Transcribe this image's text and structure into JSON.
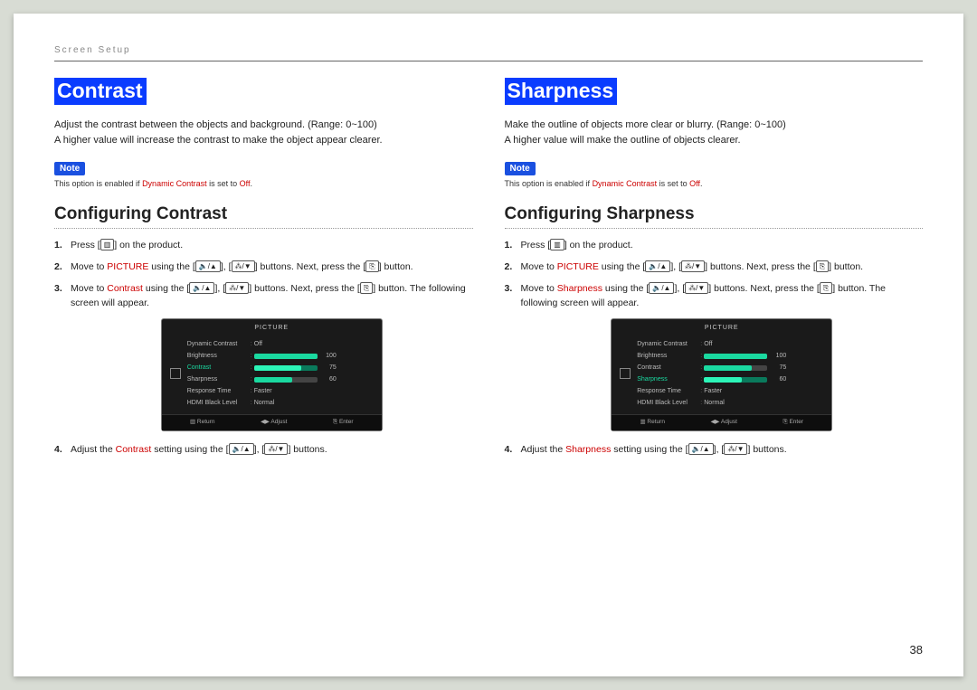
{
  "header": "Screen Setup",
  "page_number": "38",
  "icons": {
    "menu": "▥",
    "up": "🔈/▲",
    "down": "⁂/▼",
    "enter": "⎘"
  },
  "left": {
    "title": "Contrast",
    "desc_line1": "Adjust the contrast between the objects and background. (Range: 0~100)",
    "desc_line2": "A higher value will increase the contrast to make the object appear clearer.",
    "note_badge": "Note",
    "note_prefix": "This option is enabled if ",
    "note_dc": "Dynamic Contrast",
    "note_suffix": " is set to ",
    "note_off": "Off",
    "h2": "Configuring Contrast",
    "step1_a": "Press [",
    "step1_b": "] on the product.",
    "step2_a": "Move to ",
    "step2_pic": "PICTURE",
    "step2_b": " using the [",
    "step2_c": "], [",
    "step2_d": "] buttons. Next, press the [",
    "step2_e": "] button.",
    "step3_a": "Move to ",
    "step3_item": "Contrast",
    "step3_b": " using the [",
    "step3_c": "], [",
    "step3_d": "] buttons. Next, press the [",
    "step3_e": "] button. The following screen will appear.",
    "step4_a": "Adjust the ",
    "step4_item": "Contrast",
    "step4_b": " setting using the [",
    "step4_c": "], [",
    "step4_d": "] buttons.",
    "osd": {
      "title": "PICTURE",
      "rows": [
        {
          "label": "Dynamic Contrast",
          "type": "text",
          "value": "Off"
        },
        {
          "label": "Brightness",
          "type": "bar",
          "value": 100,
          "pct": 100
        },
        {
          "label": "Contrast",
          "type": "bar",
          "value": 75,
          "pct": 75,
          "hl": true
        },
        {
          "label": "Sharpness",
          "type": "bar",
          "value": 60,
          "pct": 60
        },
        {
          "label": "Response Time",
          "type": "text",
          "value": "Faster"
        },
        {
          "label": "HDMI Black Level",
          "type": "text",
          "value": "Normal"
        }
      ],
      "foot": [
        "▥ Return",
        "◀▶ Adjust",
        "⎘ Enter"
      ]
    }
  },
  "right": {
    "title": "Sharpness",
    "desc_line1": "Make the outline of objects more clear or blurry. (Range: 0~100)",
    "desc_line2": "A higher value will make the outline of objects clearer.",
    "note_badge": "Note",
    "note_prefix": "This option is enabled if ",
    "note_dc": "Dynamic Contrast",
    "note_suffix": " is set to ",
    "note_off": "Off",
    "h2": "Configuring Sharpness",
    "step1_a": "Press [",
    "step1_b": "] on the product.",
    "step2_a": "Move to ",
    "step2_pic": "PICTURE",
    "step2_b": " using the [",
    "step2_c": "], [",
    "step2_d": "] buttons. Next, press the [",
    "step2_e": "] button.",
    "step3_a": "Move to ",
    "step3_item": "Sharpness",
    "step3_b": " using the [",
    "step3_c": "], [",
    "step3_d": "] buttons. Next, press the [",
    "step3_e": "] button. The following screen will appear.",
    "step4_a": "Adjust the ",
    "step4_item": "Sharpness",
    "step4_b": " setting using the [",
    "step4_c": "], [",
    "step4_d": "] buttons.",
    "osd": {
      "title": "PICTURE",
      "rows": [
        {
          "label": "Dynamic Contrast",
          "type": "text",
          "value": "Off"
        },
        {
          "label": "Brightness",
          "type": "bar",
          "value": 100,
          "pct": 100
        },
        {
          "label": "Contrast",
          "type": "bar",
          "value": 75,
          "pct": 75
        },
        {
          "label": "Sharpness",
          "type": "bar",
          "value": 60,
          "pct": 60,
          "hl": true
        },
        {
          "label": "Response Time",
          "type": "text",
          "value": "Faster"
        },
        {
          "label": "HDMI Black Level",
          "type": "text",
          "value": "Normal"
        }
      ],
      "foot": [
        "▥ Return",
        "◀▶ Adjust",
        "⎘ Enter"
      ]
    }
  }
}
